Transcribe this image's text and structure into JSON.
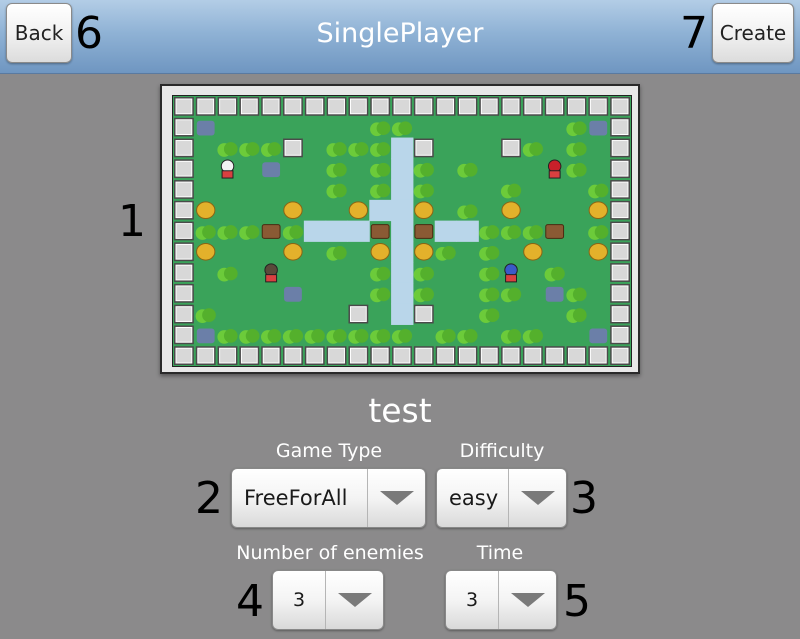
{
  "header": {
    "back_label": "Back",
    "title": "SinglePlayer",
    "create_label": "Create"
  },
  "annotations": {
    "map": "1",
    "game_type": "2",
    "difficulty": "3",
    "enemies": "4",
    "time": "5",
    "back": "6",
    "create": "7"
  },
  "level": {
    "name": "test"
  },
  "form": {
    "game_type_label": "Game Type",
    "game_type_value": "FreeForAll",
    "difficulty_label": "Difficulty",
    "difficulty_value": "easy",
    "enemies_label": "Number of enemies",
    "enemies_value": "3",
    "time_label": "Time",
    "time_value": "3"
  },
  "map_preview": {
    "cols": 21,
    "rows": 13,
    "legend": {
      "W": "wall-block",
      "S": "stone-block",
      "B": "bush",
      "R": "rock",
      "G": "gold-barrel",
      "C": "chest",
      "w": "water",
      "P": "player-white",
      "E": "enemy-red",
      "K": "enemy-dark",
      "U": "enemy-blue",
      ".": "grass"
    },
    "grid": [
      "WWWWWWWWWWWWWWWWWWWWW",
      "WR.......BB.......BRW",
      "W.BBBS.BBBwS...SB.B.W",
      "W.P.R..B.BwB.B...EB.W",
      "W......B.BwB...B...BW",
      "WG...G..GwwG.B.G...GW",
      "WBBBCBwwwCwCwwBBBC.BW",
      "WG...G.B.GwGB.B.G..GW",
      "W.B.K....BwB..BU.B..W",
      "W....R...BwB..BB.RB.W",
      "WB......S.wS..B...B.W",
      "WRBBBBBBBBB.BB.BB..RW",
      "WWWWWWWWWWWWWWWWWWWWW"
    ],
    "colors": {
      "grass": "#3aa35a",
      "water": "#b9d6ea",
      "bush": "#6ccb3a",
      "wall": "#d8d8d8",
      "gold": "#e3b12b",
      "chest": "#8a5a34",
      "rock": "#6b7fa8"
    }
  }
}
